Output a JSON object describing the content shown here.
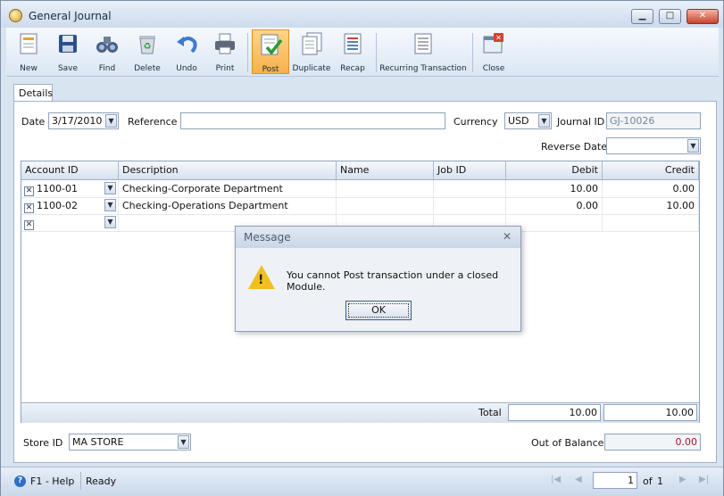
{
  "window": {
    "title": "General Journal"
  },
  "toolbar": {
    "items": [
      {
        "label": "New",
        "icon": "new-document-icon"
      },
      {
        "label": "Save",
        "icon": "floppy-disk-icon"
      },
      {
        "label": "Find",
        "icon": "binoculars-icon"
      },
      {
        "label": "Delete",
        "icon": "recycle-bin-icon"
      },
      {
        "label": "Undo",
        "icon": "undo-arrow-icon"
      },
      {
        "label": "Print",
        "icon": "printer-icon"
      },
      {
        "label": "Post",
        "icon": "post-checkmark-icon",
        "active": true
      },
      {
        "label": "Duplicate",
        "icon": "duplicate-pages-icon"
      },
      {
        "label": "Recap",
        "icon": "recap-report-icon"
      },
      {
        "label": "Recurring Transaction",
        "icon": "recurring-document-icon"
      },
      {
        "label": "Close",
        "icon": "close-window-icon"
      }
    ]
  },
  "tabs": [
    {
      "label": "Details"
    }
  ],
  "form": {
    "date_label": "Date",
    "date_value": "3/17/2010",
    "reference_label": "Reference",
    "reference_value": "",
    "currency_label": "Currency",
    "currency_value": "USD",
    "journal_id_label": "Journal ID",
    "journal_id_value": "GJ-10026",
    "reverse_date_label": "Reverse Date",
    "reverse_date_value": ""
  },
  "grid": {
    "columns": [
      "Account ID",
      "Description",
      "Name",
      "Job ID",
      "Debit",
      "Credit"
    ],
    "rows": [
      {
        "account_id": "1100-01",
        "description": "Checking-Corporate Department",
        "name": "",
        "job_id": "",
        "debit": "10.00",
        "credit": "0.00"
      },
      {
        "account_id": "1100-02",
        "description": "Checking-Operations Department",
        "name": "",
        "job_id": "",
        "debit": "0.00",
        "credit": "10.00"
      },
      {
        "account_id": "",
        "description": "",
        "name": "",
        "job_id": "",
        "debit": "",
        "credit": ""
      }
    ],
    "total_label": "Total",
    "total_debit": "10.00",
    "total_credit": "10.00"
  },
  "footer": {
    "store_id_label": "Store ID",
    "store_id_value": "MA STORE",
    "out_of_balance_label": "Out of Balance",
    "out_of_balance_value": "0.00"
  },
  "statusbar": {
    "help": "F1 - Help",
    "status": "Ready",
    "page_current": "1",
    "page_of": "of",
    "page_total": "1"
  },
  "dialog": {
    "title": "Message",
    "message": "You cannot Post transaction under a closed Module.",
    "ok_label": "OK"
  },
  "colors": {
    "accent": "#f7b04a",
    "chrome": "#d9e4f1",
    "warning": "#f0c020",
    "out_of_balance": "#a0162a"
  }
}
